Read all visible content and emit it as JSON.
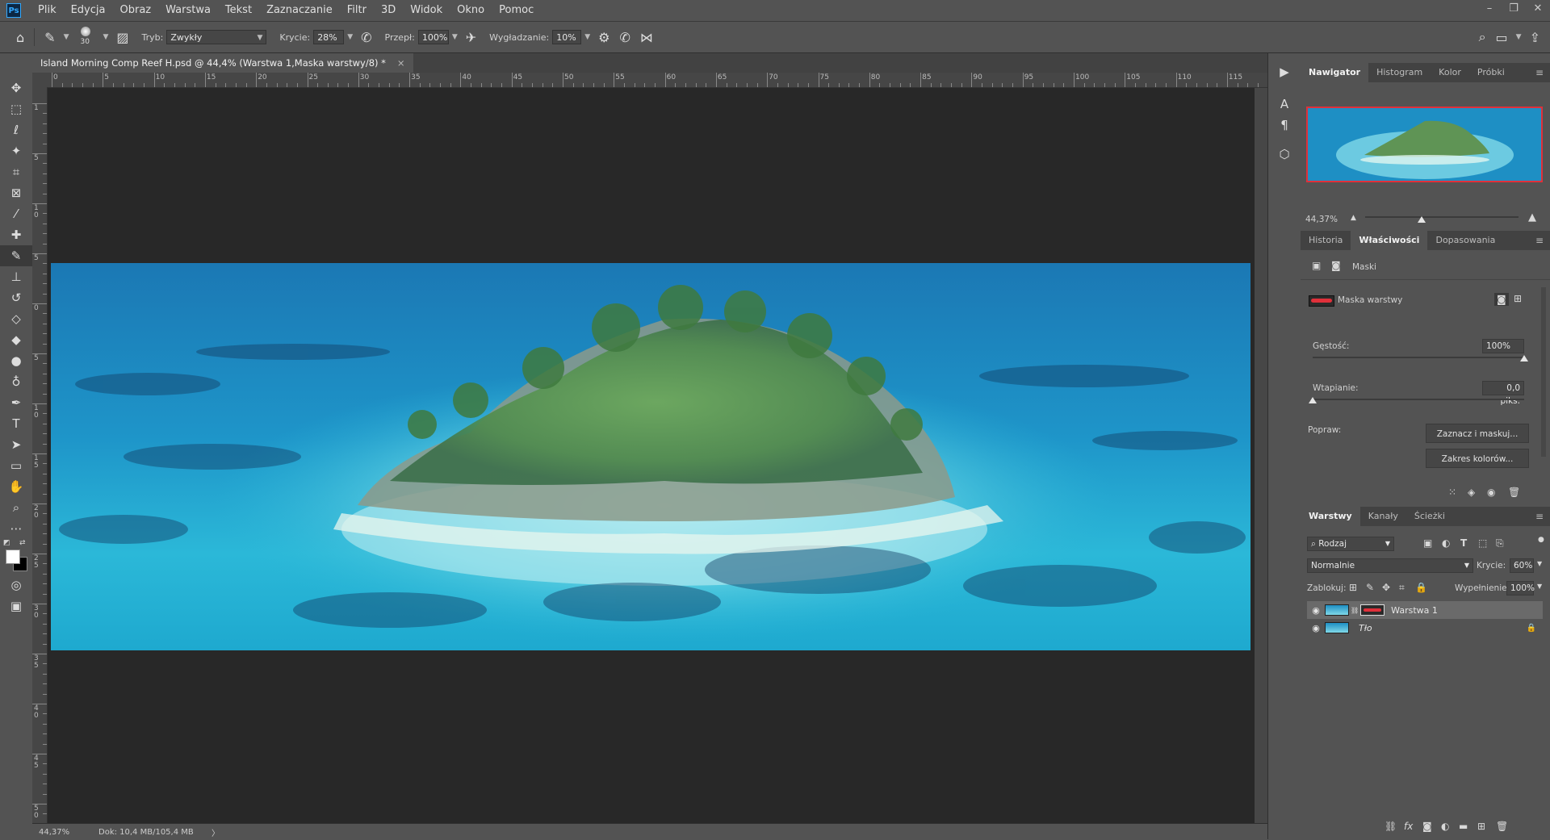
{
  "menu": {
    "logo": "Ps",
    "items": [
      "Plik",
      "Edycja",
      "Obraz",
      "Warstwa",
      "Tekst",
      "Zaznaczanie",
      "Filtr",
      "3D",
      "Widok",
      "Okno",
      "Pomoc"
    ]
  },
  "window_controls": [
    "–",
    "❐",
    "✕"
  ],
  "options": {
    "brush_size": "30",
    "mode_label": "Tryb:",
    "mode_value": "Zwykły",
    "opacity_label": "Krycie:",
    "opacity_value": "28%",
    "flow_label": "Przepł:",
    "flow_value": "100%",
    "smoothing_label": "Wygładzanie:",
    "smoothing_value": "10%"
  },
  "document": {
    "tab_title": "Island Morning Comp Reef H.psd @ 44,4% (Warstwa 1,Maska warstwy/8) *",
    "close": "×"
  },
  "ruler": {
    "h_labels": [
      "0",
      "5",
      "10",
      "15",
      "20",
      "25",
      "30",
      "35",
      "40",
      "45",
      "50",
      "55",
      "60",
      "65",
      "70",
      "75",
      "80",
      "85",
      "90",
      "95",
      "100",
      "105",
      "110",
      "115"
    ],
    "v_labels": [
      "1",
      "5",
      "1 0",
      "5",
      "0",
      "5",
      "1 0",
      "1 5",
      "2 0",
      "2 5",
      "3 0",
      "3 5",
      "4 0",
      "4 5",
      "5 0"
    ]
  },
  "status": {
    "zoom": "44,37%",
    "doc_info": "Dok: 10,4 MB/105,4 MB",
    "arrow": "〉"
  },
  "navigator": {
    "tabs": [
      "Nawigator",
      "Histogram",
      "Kolor",
      "Próbki"
    ],
    "zoom": "44,37%"
  },
  "properties": {
    "tabs": [
      "Historia",
      "Właściwości",
      "Dopasowania"
    ],
    "masks_label": "Maski",
    "layer_mask_label": "Maska warstwy",
    "density_label": "Gęstość:",
    "density_value": "100%",
    "density_level": 1.0,
    "feather_label": "Wtapianie:",
    "feather_value": "0,0 piks.",
    "feather_level": 0.0,
    "refine_label": "Popraw:",
    "select_mask_button": "Zaznacz i maskuj...",
    "color_range_button": "Zakres kolorów..."
  },
  "layers": {
    "tabs": [
      "Warstwy",
      "Kanały",
      "Ścieżki"
    ],
    "filter_value": "Rodzaj",
    "blend_mode": "Normalnie",
    "opacity_label": "Krycie:",
    "opacity_value": "60%",
    "lock_label": "Zablokuj:",
    "fill_label": "Wypełnienie:",
    "fill_value": "100%",
    "items": [
      {
        "name": "Warstwa 1",
        "selected": true
      },
      {
        "name": "Tło",
        "selected": false
      }
    ]
  },
  "colors": {
    "accent_red": "#e0303a",
    "panel_bg": "#535353",
    "canvas_bg": "#282828",
    "ocean": "#1a8fc4"
  }
}
